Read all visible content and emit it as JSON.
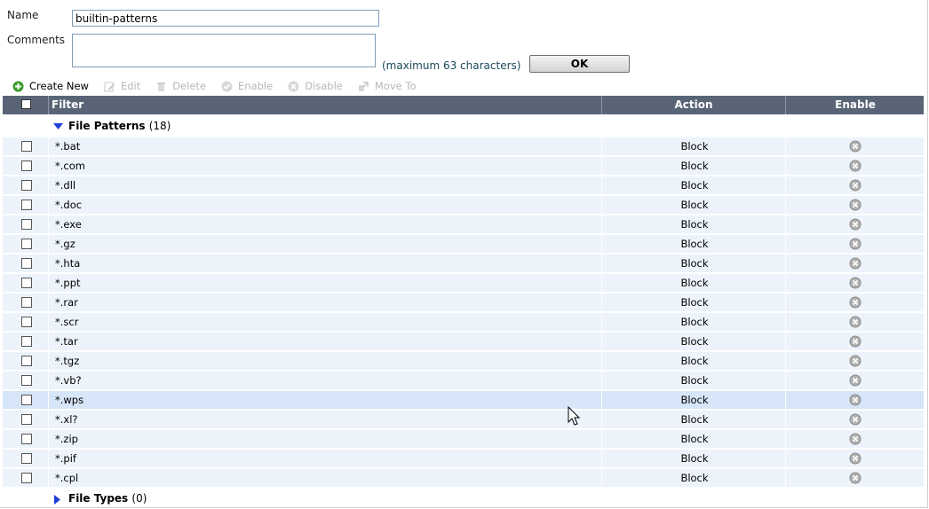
{
  "form": {
    "name_label": "Name",
    "name_value": "builtin-patterns",
    "comments_label": "Comments",
    "comments_value": "",
    "max_hint": "(maximum 63 characters)",
    "ok_label": "OK"
  },
  "toolbar": {
    "create_new": "Create New",
    "edit": "Edit",
    "delete": "Delete",
    "enable": "Enable",
    "disable": "Disable",
    "move_to": "Move To"
  },
  "table": {
    "columns": {
      "filter": "Filter",
      "action": "Action",
      "enable": "Enable"
    },
    "groups": [
      {
        "label": "File Patterns",
        "count": "(18)",
        "expanded": true
      },
      {
        "label": "File Types",
        "count": "(0)",
        "expanded": false
      }
    ],
    "rows": [
      {
        "filter": "*.bat",
        "action": "Block",
        "selected": false
      },
      {
        "filter": "*.com",
        "action": "Block",
        "selected": false
      },
      {
        "filter": "*.dll",
        "action": "Block",
        "selected": false
      },
      {
        "filter": "*.doc",
        "action": "Block",
        "selected": false
      },
      {
        "filter": "*.exe",
        "action": "Block",
        "selected": false
      },
      {
        "filter": "*.gz",
        "action": "Block",
        "selected": false
      },
      {
        "filter": "*.hta",
        "action": "Block",
        "selected": false
      },
      {
        "filter": "*.ppt",
        "action": "Block",
        "selected": false
      },
      {
        "filter": "*.rar",
        "action": "Block",
        "selected": false
      },
      {
        "filter": "*.scr",
        "action": "Block",
        "selected": false
      },
      {
        "filter": "*.tar",
        "action": "Block",
        "selected": false
      },
      {
        "filter": "*.tgz",
        "action": "Block",
        "selected": false
      },
      {
        "filter": "*.vb?",
        "action": "Block",
        "selected": false
      },
      {
        "filter": "*.wps",
        "action": "Block",
        "selected": true
      },
      {
        "filter": "*.xl?",
        "action": "Block",
        "selected": false
      },
      {
        "filter": "*.zip",
        "action": "Block",
        "selected": false
      },
      {
        "filter": "*.pif",
        "action": "Block",
        "selected": false
      },
      {
        "filter": "*.cpl",
        "action": "Block",
        "selected": false
      }
    ]
  },
  "colors": {
    "header_bg": "#596577",
    "row_bg": "#ecf3fb",
    "row_selected_bg": "#d6e5f7",
    "group_arrow": "#1f3fd6"
  },
  "icons": {
    "create_new": "plus-circle-icon",
    "edit": "pencil-icon",
    "delete": "trash-icon",
    "enable": "check-circle-icon",
    "disable": "x-circle-icon",
    "move_to": "move-icon",
    "enable_state": "disabled-x-circle-icon"
  }
}
